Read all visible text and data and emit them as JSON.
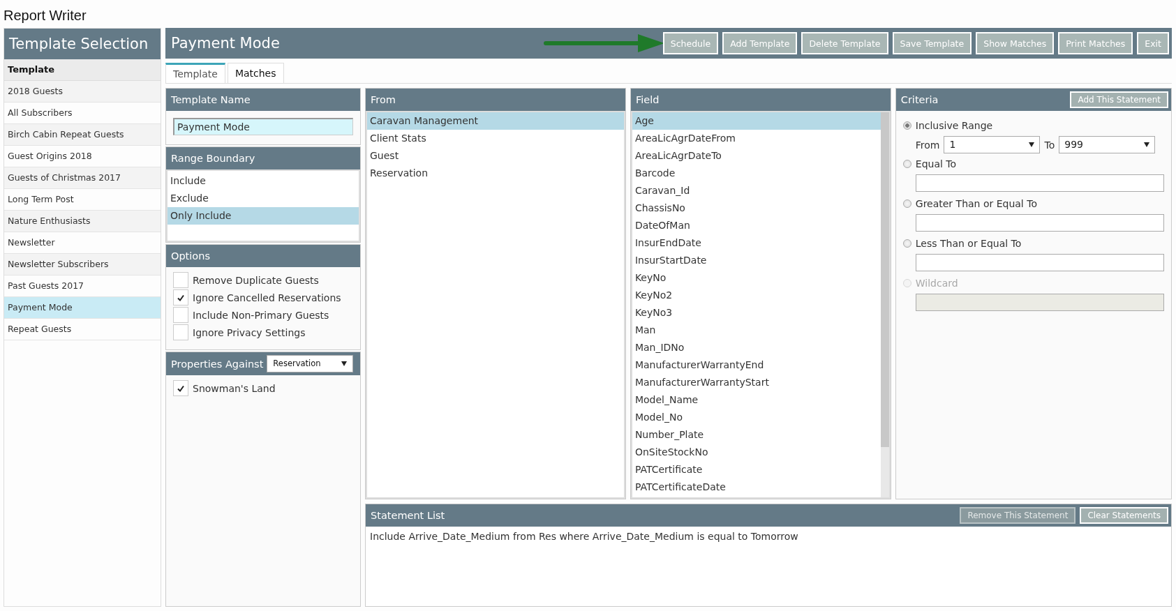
{
  "app_title": "Report Writer",
  "sidebar": {
    "title": "Template Selection",
    "header": "Template",
    "items": [
      {
        "label": "2018 Guests",
        "selected": false
      },
      {
        "label": "All Subscribers",
        "selected": false
      },
      {
        "label": "Birch Cabin Repeat Guests",
        "selected": false
      },
      {
        "label": "Guest Origins 2018",
        "selected": false
      },
      {
        "label": "Guests of Christmas 2017",
        "selected": false
      },
      {
        "label": "Long Term Post",
        "selected": false
      },
      {
        "label": "Nature Enthusiasts",
        "selected": false
      },
      {
        "label": "Newsletter",
        "selected": false
      },
      {
        "label": "Newsletter Subscribers",
        "selected": false
      },
      {
        "label": "Past Guests 2017",
        "selected": false
      },
      {
        "label": "Payment Mode",
        "selected": true
      },
      {
        "label": "Repeat Guests",
        "selected": false
      }
    ]
  },
  "main": {
    "title": "Payment Mode",
    "buttons": [
      "Schedule",
      "Add Template",
      "Delete Template",
      "Save Template",
      "Show Matches",
      "Print Matches",
      "Exit"
    ]
  },
  "tabs": [
    {
      "label": "Template",
      "selected": true
    },
    {
      "label": "Matches",
      "selected": false
    }
  ],
  "template_name": {
    "title": "Template Name",
    "value": "Payment Mode"
  },
  "range_boundary": {
    "title": "Range Boundary",
    "items": [
      {
        "label": "Include",
        "selected": false
      },
      {
        "label": "Exclude",
        "selected": false
      },
      {
        "label": "Only Include",
        "selected": true
      }
    ]
  },
  "options": {
    "title": "Options",
    "items": [
      {
        "label": "Remove Duplicate Guests",
        "checked": false
      },
      {
        "label": "Ignore Cancelled Reservations",
        "checked": true
      },
      {
        "label": "Include Non-Primary Guests",
        "checked": false
      },
      {
        "label": "Ignore Privacy Settings",
        "checked": false
      }
    ]
  },
  "properties": {
    "title": "Properties Against",
    "select_value": "Reservation",
    "items": [
      {
        "label": "Snowman's Land",
        "checked": true
      }
    ]
  },
  "from": {
    "title": "From",
    "items": [
      {
        "label": "Caravan Management",
        "selected": true
      },
      {
        "label": "Client Stats",
        "selected": false
      },
      {
        "label": "Guest",
        "selected": false
      },
      {
        "label": "Reservation",
        "selected": false
      }
    ]
  },
  "field": {
    "title": "Field",
    "items": [
      {
        "label": "Age",
        "selected": true
      },
      {
        "label": "AreaLicAgrDateFrom",
        "selected": false
      },
      {
        "label": "AreaLicAgrDateTo",
        "selected": false
      },
      {
        "label": "Barcode",
        "selected": false
      },
      {
        "label": "Caravan_Id",
        "selected": false
      },
      {
        "label": "ChassisNo",
        "selected": false
      },
      {
        "label": "DateOfMan",
        "selected": false
      },
      {
        "label": "InsurEndDate",
        "selected": false
      },
      {
        "label": "InsurStartDate",
        "selected": false
      },
      {
        "label": "KeyNo",
        "selected": false
      },
      {
        "label": "KeyNo2",
        "selected": false
      },
      {
        "label": "KeyNo3",
        "selected": false
      },
      {
        "label": "Man",
        "selected": false
      },
      {
        "label": "Man_IDNo",
        "selected": false
      },
      {
        "label": "ManufacturerWarrantyEnd",
        "selected": false
      },
      {
        "label": "ManufacturerWarrantyStart",
        "selected": false
      },
      {
        "label": "Model_Name",
        "selected": false
      },
      {
        "label": "Model_No",
        "selected": false
      },
      {
        "label": "Number_Plate",
        "selected": false
      },
      {
        "label": "OnSiteStockNo",
        "selected": false
      },
      {
        "label": "PATCertificate",
        "selected": false
      },
      {
        "label": "PATCertificateDate",
        "selected": false
      }
    ]
  },
  "criteria": {
    "title": "Criteria",
    "add_button": "Add This Statement",
    "options": [
      {
        "kind": "range",
        "label": "Inclusive Range",
        "selected": true,
        "disabled": false,
        "from_label": "From",
        "from_value": "1",
        "to_label": "To",
        "to_value": "999"
      },
      {
        "kind": "text",
        "label": "Equal To",
        "selected": false,
        "disabled": false
      },
      {
        "kind": "text",
        "label": "Greater Than or Equal To",
        "selected": false,
        "disabled": false
      },
      {
        "kind": "text",
        "label": "Less Than or Equal To",
        "selected": false,
        "disabled": false
      },
      {
        "kind": "text",
        "label": "Wildcard",
        "selected": false,
        "disabled": true
      }
    ]
  },
  "statements": {
    "title": "Statement List",
    "buttons": [
      {
        "label": "Remove This Statement",
        "disabled": true
      },
      {
        "label": "Clear Statements",
        "disabled": false
      }
    ],
    "items": [
      "Include Arrive_Date_Medium from Res where Arrive_Date_Medium is equal to Tomorrow"
    ]
  }
}
